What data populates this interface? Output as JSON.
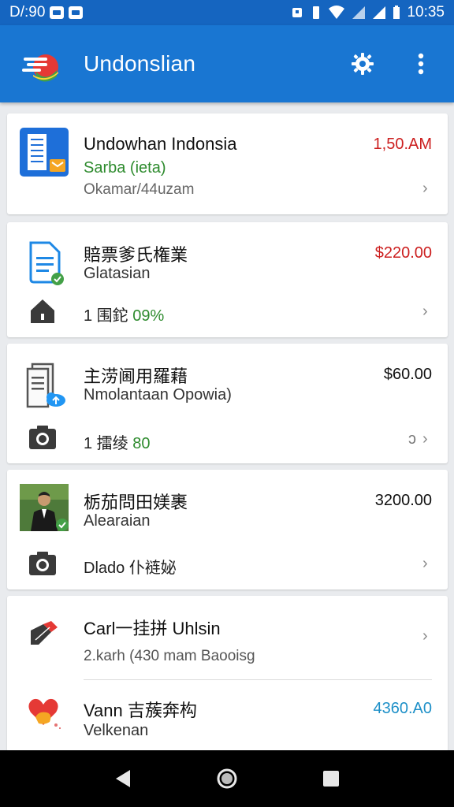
{
  "status_bar": {
    "left_text": "D/:90",
    "time": "10:35"
  },
  "app_bar": {
    "title": "Undonslian",
    "logo_icon": "flag-logo-icon",
    "actions": [
      "settings-gear-icon",
      "more-vert-icon"
    ]
  },
  "items": [
    {
      "title": "Undowhan Indonsia",
      "subtitle": "Sarba (ieta)",
      "meta": "Okamar/44uzam",
      "amount": "1,50.AM",
      "amount_color": "#cc1f1f",
      "thumb_icon": "document-folder-icon"
    },
    {
      "title": "賠票爹氏権業",
      "subtitle": "Glatasian",
      "row_text_prefix": "1 围鉈 ",
      "row_text_accent": "09%",
      "amount": "$220.00",
      "amount_color": "#cc1f1f",
      "thumb_icon": "document-check-icon",
      "row_icon": "home-icon"
    },
    {
      "title": "主涝阃用羅藉",
      "subtitle": "Nmolantaan Opowia)",
      "row_text_prefix": "1 擂绫 ",
      "row_text_accent": "80",
      "trailing": "ɔ",
      "amount": "$60.00",
      "amount_color": "#111111",
      "thumb_icon": "document-cloud-icon",
      "row_icon": "camera-icon"
    },
    {
      "title": "栃茄問田媄裹",
      "subtitle": "Alearaian",
      "row_text_prefix": "Dlado 仆裢妼",
      "amount": "3200.00",
      "amount_color": "#111111",
      "thumb_icon": "person-photo-icon",
      "row_icon": "camera-icon"
    },
    {
      "title": "Carl一挂拼 Uhlsin",
      "meta": "2.karh (430 mam Baooisg",
      "thumb_icon": "pen-edit-icon"
    },
    {
      "title": "Vann 吉蔟奔构",
      "subtitle": "Velkenan",
      "amount": "4360.A0",
      "amount_color": "#1e90c8",
      "thumb_icon": "heart-hands-icon"
    }
  ],
  "nav_bar": [
    "back-icon",
    "home-circle-icon",
    "recents-square-icon"
  ]
}
